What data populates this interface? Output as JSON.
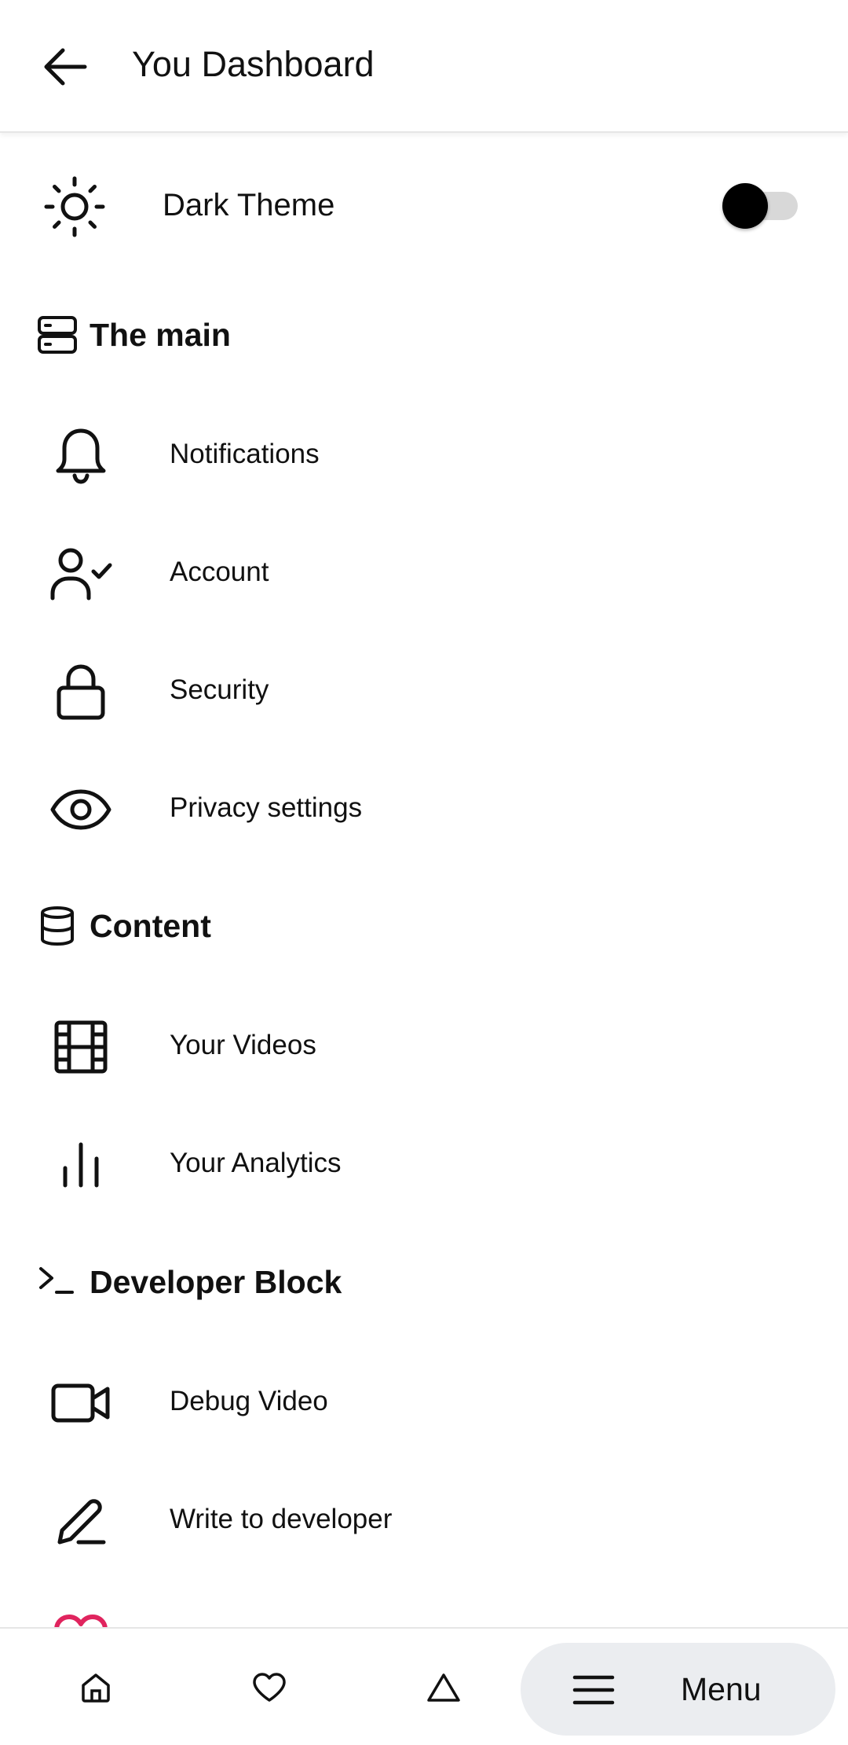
{
  "header": {
    "title": "You Dashboard"
  },
  "theme": {
    "label": "Dark Theme",
    "enabled": false
  },
  "sections": {
    "main": {
      "title": "The main",
      "items": [
        {
          "label": "Notifications",
          "icon": "bell-icon"
        },
        {
          "label": "Account",
          "icon": "user-check-icon"
        },
        {
          "label": "Security",
          "icon": "lock-icon"
        },
        {
          "label": "Privacy settings",
          "icon": "eye-icon"
        }
      ]
    },
    "content": {
      "title": "Content",
      "items": [
        {
          "label": "Your Videos",
          "icon": "film-icon"
        },
        {
          "label": "Your Analytics",
          "icon": "bar-chart-icon"
        }
      ]
    },
    "developer": {
      "title": "Developer Block",
      "items": [
        {
          "label": "Debug Video",
          "icon": "video-camera-icon"
        },
        {
          "label": "Write to developer",
          "icon": "pencil-icon"
        },
        {
          "label": "",
          "icon": "heart-icon",
          "icon_color": "#e0245e"
        }
      ]
    }
  },
  "bottom_nav": {
    "items": [
      {
        "icon": "home-icon"
      },
      {
        "icon": "heart-icon"
      },
      {
        "icon": "triangle-icon"
      }
    ],
    "menu_label": "Menu"
  }
}
